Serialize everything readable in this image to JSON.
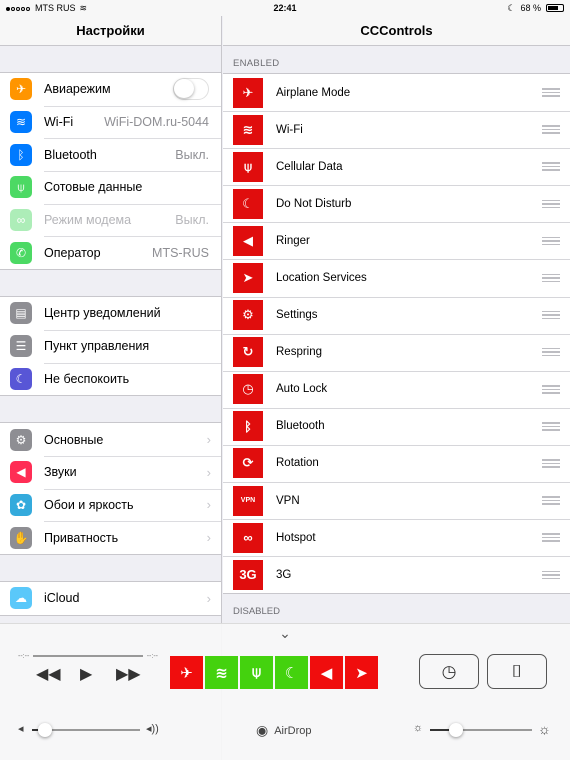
{
  "status_bar": {
    "carrier": "MTS RUS",
    "time": "22:41",
    "battery": "68 %"
  },
  "settings_panel": {
    "title": "Настройки",
    "groups": [
      [
        {
          "label": "Авиарежим",
          "icon": "airplane-icon",
          "color": "#ff9500",
          "type": "switch"
        },
        {
          "label": "Wi-Fi",
          "value": "WiFi-DOM.ru-5044",
          "icon": "wifi-icon",
          "color": "#007aff"
        },
        {
          "label": "Bluetooth",
          "value": "Выкл.",
          "icon": "bluetooth-icon",
          "color": "#007aff"
        },
        {
          "label": "Сотовые данные",
          "icon": "cellular-icon",
          "color": "#4cd964"
        },
        {
          "label": "Режим модема",
          "value": "Выкл.",
          "icon": "hotspot-icon",
          "color": "#4cd964",
          "dim": true
        },
        {
          "label": "Оператор",
          "value": "MTS-RUS",
          "icon": "phone-icon",
          "color": "#4cd964"
        }
      ],
      [
        {
          "label": "Центр уведомлений",
          "icon": "notifications-icon",
          "color": "#8e8e93"
        },
        {
          "label": "Пункт управления",
          "icon": "control-center-icon",
          "color": "#8e8e93"
        },
        {
          "label": "Не беспокоить",
          "icon": "moon-icon",
          "color": "#5856d6"
        }
      ],
      [
        {
          "label": "Основные",
          "icon": "gear-icon",
          "color": "#8e8e93",
          "chevron": true
        },
        {
          "label": "Звуки",
          "icon": "speaker-icon",
          "color": "#ff2d55",
          "chevron": true
        },
        {
          "label": "Обои и яркость",
          "icon": "flower-icon",
          "color": "#34aadc",
          "chevron": true
        },
        {
          "label": "Приватность",
          "icon": "hand-icon",
          "color": "#8e8e93",
          "chevron": true
        }
      ],
      [
        {
          "label": "iCloud",
          "icon": "cloud-icon",
          "color": "#5ac8fa",
          "chevron": true
        }
      ]
    ]
  },
  "ccontrols_panel": {
    "title": "CCControls",
    "enabled_header": "ENABLED",
    "enabled": [
      {
        "label": "Airplane Mode",
        "icon": "airplane-icon",
        "glyph": "✈"
      },
      {
        "label": "Wi-Fi",
        "icon": "wifi-icon",
        "glyph": "≋"
      },
      {
        "label": "Cellular Data",
        "icon": "cellular-icon",
        "glyph": "⍦"
      },
      {
        "label": "Do Not Disturb",
        "icon": "moon-icon",
        "glyph": "☾"
      },
      {
        "label": "Ringer",
        "icon": "speaker-icon",
        "glyph": "◀"
      },
      {
        "label": "Location Services",
        "icon": "location-arrow-icon",
        "glyph": "➤"
      },
      {
        "label": "Settings",
        "icon": "gear-icon",
        "glyph": "⚙"
      },
      {
        "label": "Respring",
        "icon": "respring-icon",
        "glyph": "↻"
      },
      {
        "label": "Auto Lock",
        "icon": "lock-timer-icon",
        "glyph": "◷"
      },
      {
        "label": "Bluetooth",
        "icon": "bluetooth-icon",
        "glyph": "ᛒ"
      },
      {
        "label": "Rotation",
        "icon": "rotation-icon",
        "glyph": "⟳"
      },
      {
        "label": "VPN",
        "icon": "vpn-icon",
        "glyph": "VPN"
      },
      {
        "label": "Hotspot",
        "icon": "link-icon",
        "glyph": "∞"
      },
      {
        "label": "3G",
        "icon": "3g-icon",
        "glyph": "3G"
      }
    ],
    "disabled_header": "DISABLED"
  },
  "control_center": {
    "time_start": "--:--",
    "time_end": "--:--",
    "airdrop_label": "AirDrop",
    "volume_level": 0.12,
    "brightness_level": 0.25,
    "toggles": [
      {
        "name": "airplane-toggle",
        "glyph": "✈",
        "on": false,
        "color": "#f00d0d"
      },
      {
        "name": "wifi-toggle",
        "glyph": "≋",
        "on": true,
        "color": "#44d20e"
      },
      {
        "name": "cellular-toggle",
        "glyph": "⍦",
        "on": true,
        "color": "#44d20e"
      },
      {
        "name": "dnd-toggle",
        "glyph": "☾",
        "on": true,
        "color": "#44d20e"
      },
      {
        "name": "ringer-toggle",
        "glyph": "◀",
        "on": false,
        "color": "#f00d0d"
      },
      {
        "name": "location-toggle",
        "glyph": "➤",
        "on": false,
        "color": "#f00d0d"
      }
    ]
  }
}
